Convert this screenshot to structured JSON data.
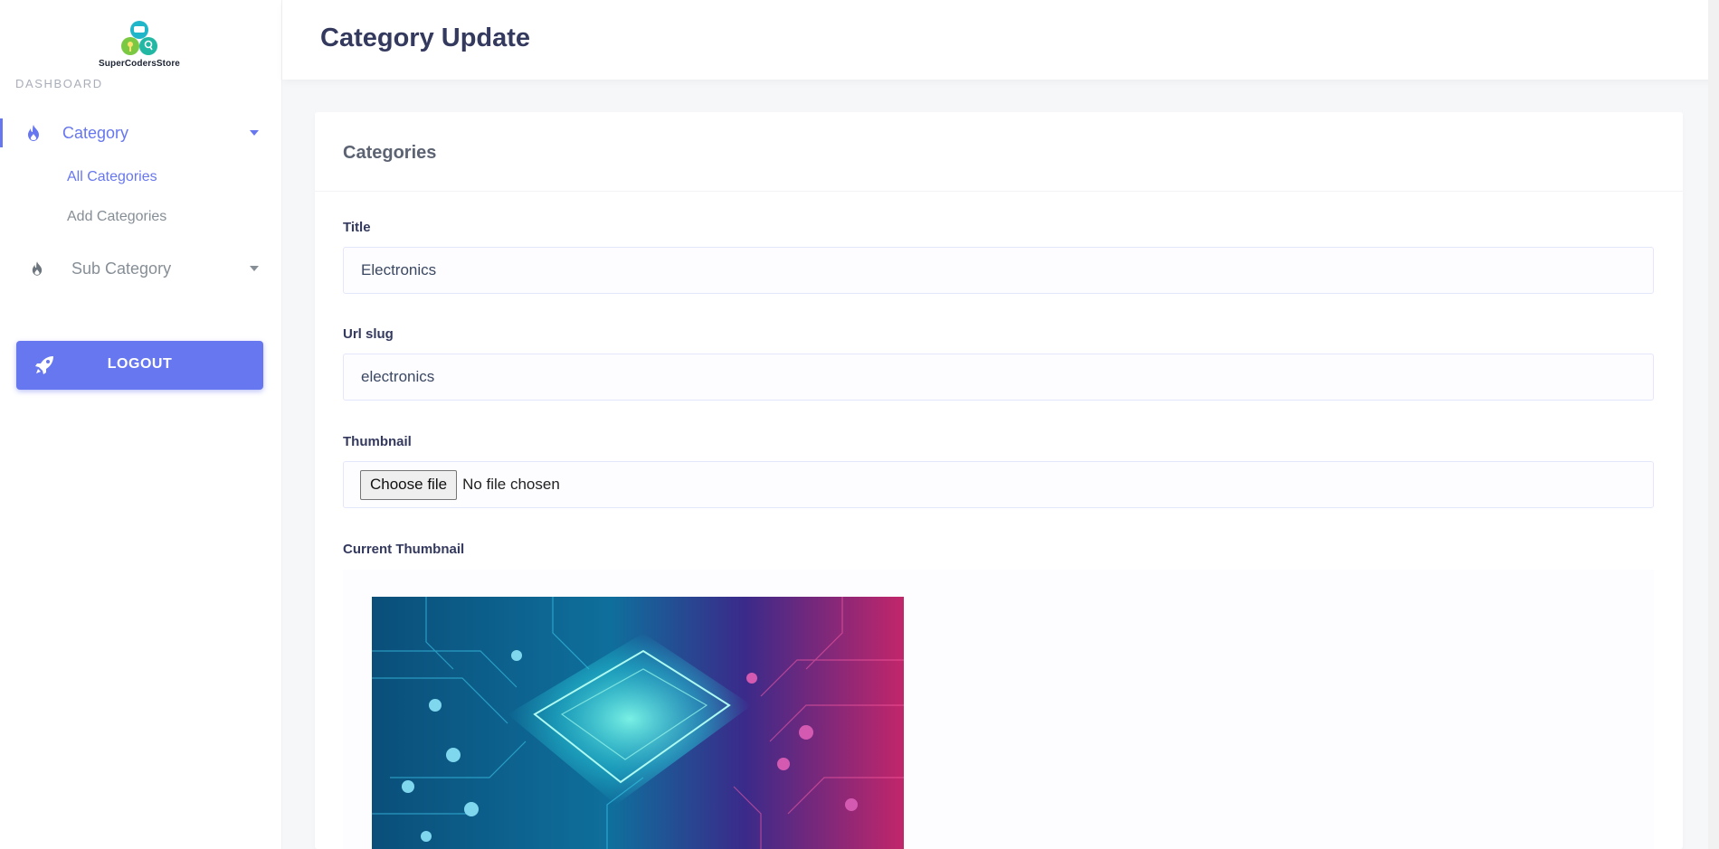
{
  "brand": {
    "name": "SuperCodersStore"
  },
  "sidebar": {
    "section_label": "DASHBOARD",
    "category": {
      "label": "Category",
      "children": [
        "All Categories",
        "Add Categories"
      ]
    },
    "sub_category": {
      "label": "Sub Category"
    },
    "logout_label": "LOGOUT"
  },
  "header": {
    "title": "Category Update"
  },
  "form": {
    "card_title": "Categories",
    "title_label": "Title",
    "title_value": "Electronics",
    "slug_label": "Url slug",
    "slug_value": "electronics",
    "thumbnail_label": "Thumbnail",
    "choose_file_label": "Choose file",
    "no_file_text": "No file chosen",
    "current_thumbnail_label": "Current Thumbnail"
  },
  "colors": {
    "primary": "#6777ef",
    "muted": "#868e96",
    "heading": "#34395e"
  },
  "icons": {
    "category": "fire-icon",
    "sub_category": "fire-icon",
    "logout": "rocket-icon",
    "expand": "caret-down-icon"
  }
}
